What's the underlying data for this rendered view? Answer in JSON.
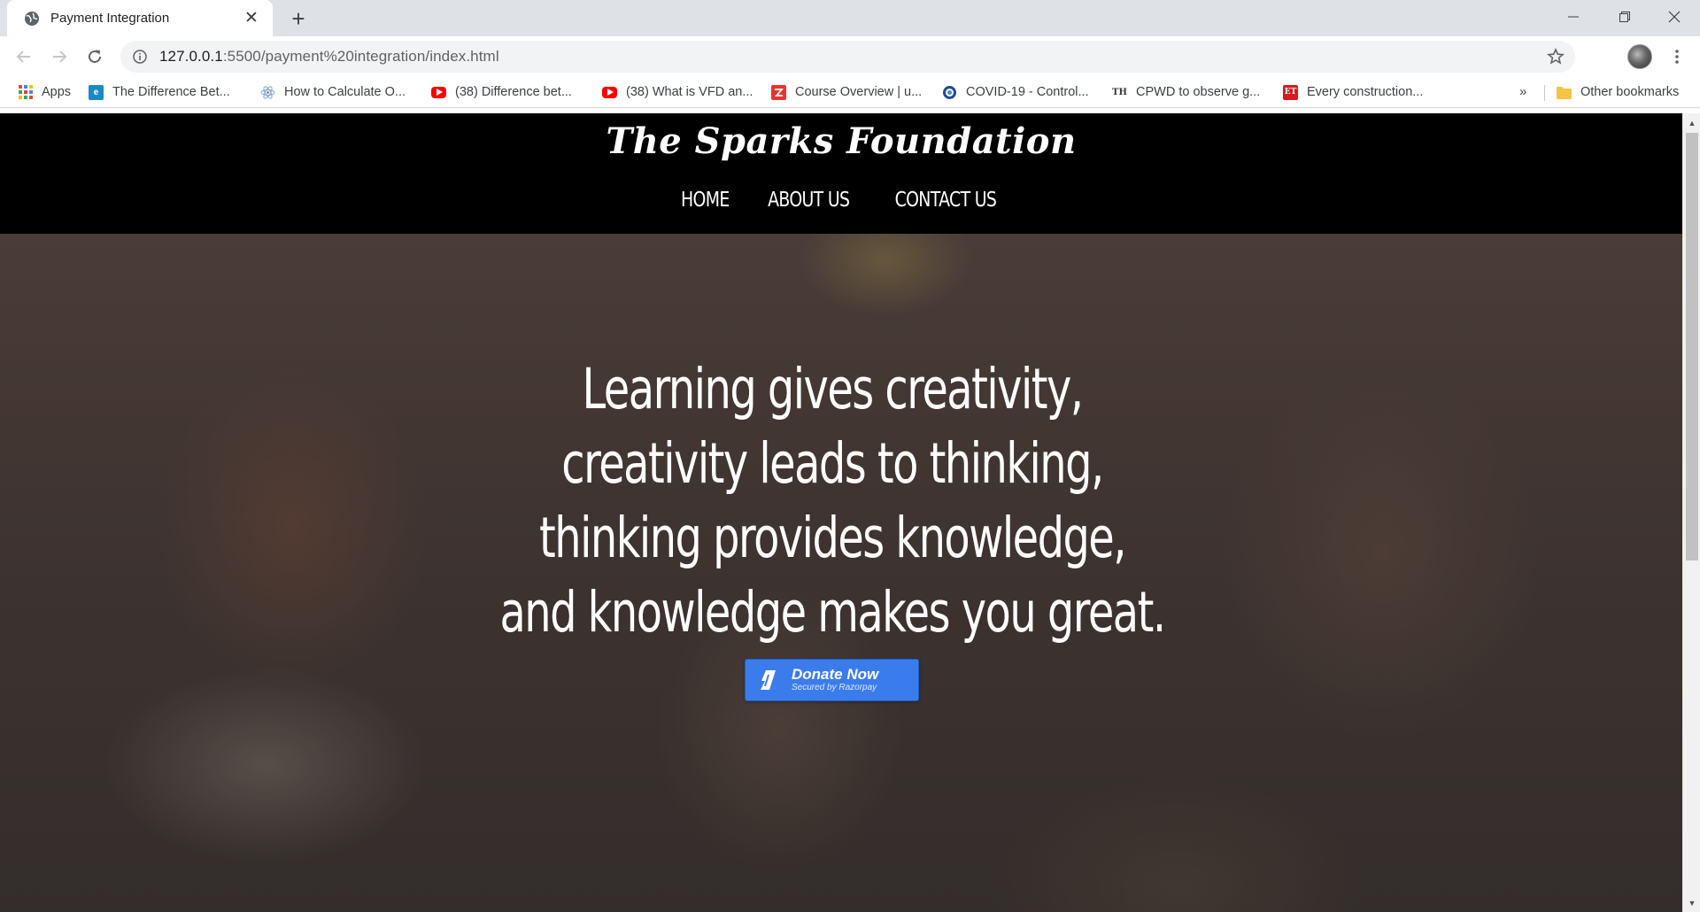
{
  "browser": {
    "tab_title": "Payment Integration",
    "url_host": "127.0.0.1",
    "url_rest": ":5500/payment%20integration/index.html",
    "bookmarks": [
      {
        "label": "Apps",
        "icon": "apps-grid-icon"
      },
      {
        "label": "The Difference Bet...",
        "icon": "e-site-icon"
      },
      {
        "label": "How to Calculate O...",
        "icon": "atom-icon"
      },
      {
        "label": "(38) Difference bet...",
        "icon": "youtube-icon"
      },
      {
        "label": "(38) What is VFD an...",
        "icon": "youtube-icon"
      },
      {
        "label": "Course Overview | u...",
        "icon": "course-icon"
      },
      {
        "label": "COVID-19 - Control...",
        "icon": "circle-site-icon"
      },
      {
        "label": "CPWD to observe g...",
        "icon": "th-icon"
      },
      {
        "label": "Every construction...",
        "icon": "et-icon"
      }
    ],
    "more_bookmarks": "»",
    "other_bookmarks": "Other bookmarks"
  },
  "site": {
    "brand": "The Sparks Foundation",
    "nav": [
      "HOME",
      "ABOUT US",
      "CONTACT US"
    ],
    "quote": [
      "Learning gives creativity,",
      "creativity leads to thinking,",
      "thinking provides knowledge,",
      "and knowledge makes you great."
    ],
    "donate_label": "Donate Now",
    "donate_sub": "Secured by Razorpay"
  },
  "colors": {
    "header_bg": "#000000",
    "donate_bg": "#3b7ced",
    "tabbar_bg": "#dee1e6"
  }
}
